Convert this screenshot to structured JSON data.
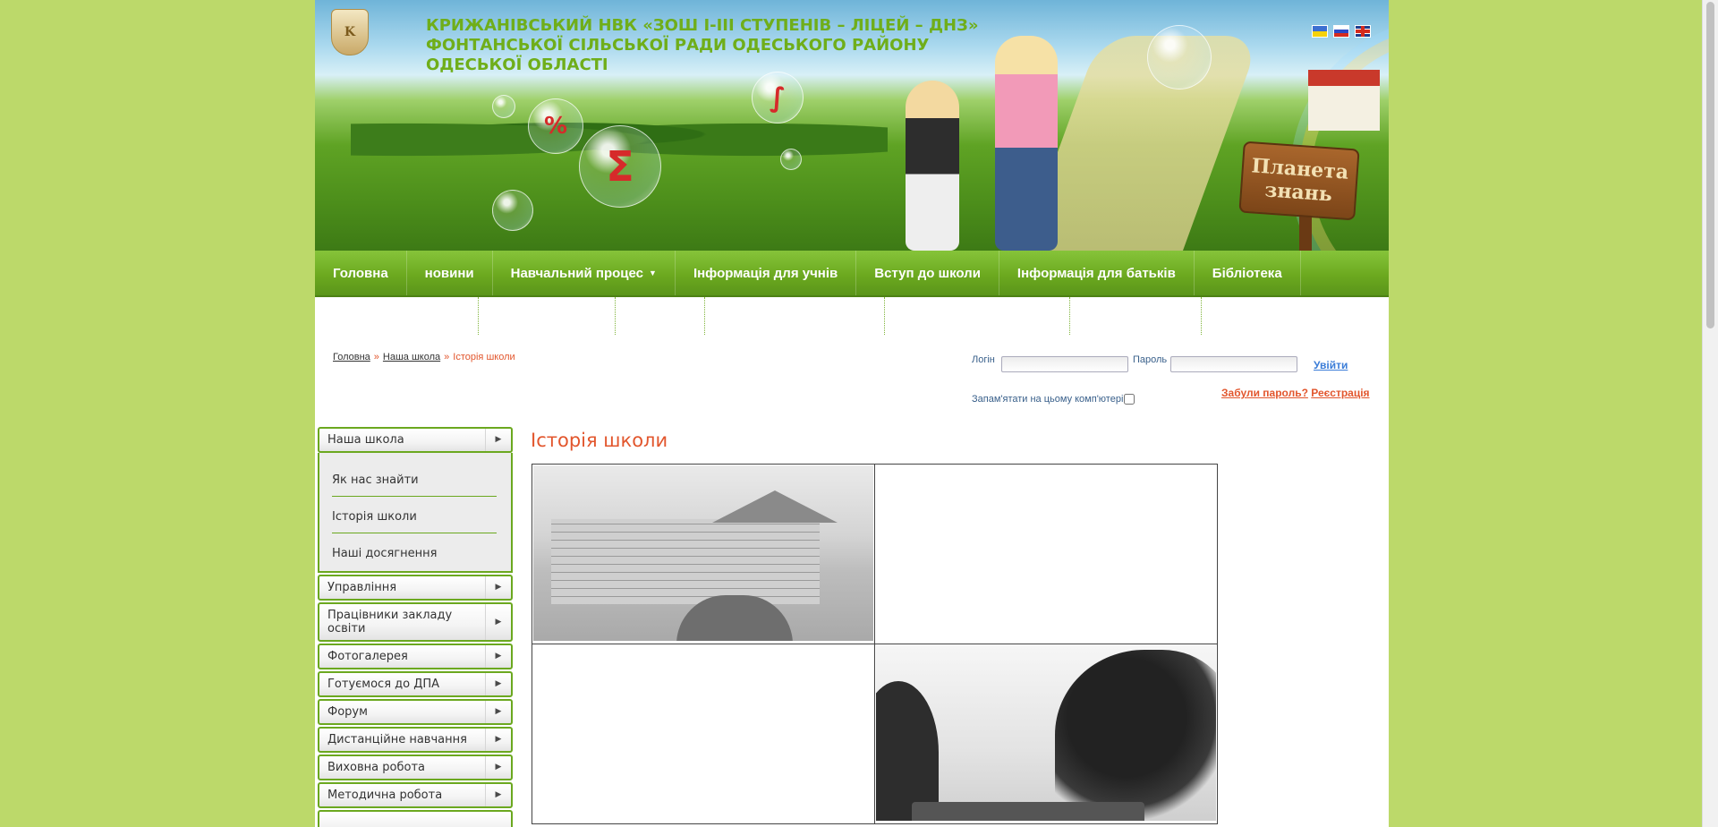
{
  "header": {
    "logo_text": "K",
    "site_title": "КРИЖАНІВСЬКИЙ НВК «ЗОШ І-ІІІ СТУПЕНІВ – ЛІЦЕЙ – ДНЗ» ФОНТАНСЬКОЇ СІЛЬСЬКОЇ РАДИ ОДЕСЬКОГО РАЙОНУ ОДЕСЬКОЇ ОБЛАСТІ",
    "sign_text": "Планета знань",
    "bubble_percent": "%",
    "bubble_sigma": "Σ",
    "bubble_integral": "∫",
    "languages": [
      "Українська",
      "Русский",
      "English"
    ]
  },
  "nav": {
    "items": [
      {
        "label": "Головна"
      },
      {
        "label": "новини"
      },
      {
        "label": "Навчальний процес",
        "caret": "▼"
      },
      {
        "label": "Інформація для учнів"
      },
      {
        "label": "Вступ до школи"
      },
      {
        "label": "Інформація для батьків"
      },
      {
        "label": "Бібліотека"
      }
    ]
  },
  "breadcrumb": {
    "home": "Головна",
    "section": "Наша школа",
    "separator": "»",
    "current": "Історія школи"
  },
  "login": {
    "login_label": "Логін",
    "password_label": "Пароль",
    "enter_label": "Увійти",
    "remember_label": "Запам'ятати на цьому комп'ютері",
    "forgot_label": "Забули пароль?",
    "register_label": "Реєстрація"
  },
  "sidebar": {
    "arrow": "▶",
    "expanded": {
      "label": "Наша школа",
      "children": [
        "Як нас знайти",
        "Історія школи",
        "Наші досягнення"
      ]
    },
    "items": [
      {
        "label": "Управління"
      },
      {
        "label": "Працівники закладу освіти"
      },
      {
        "label": "Фотогалерея"
      },
      {
        "label": "Готуємося до ДПА"
      },
      {
        "label": "Форум"
      },
      {
        "label": "Дистанційне навчання"
      },
      {
        "label": "Виховна робота"
      },
      {
        "label": "Методична робота"
      }
    ]
  },
  "main": {
    "page_title": "Історія школи"
  }
}
